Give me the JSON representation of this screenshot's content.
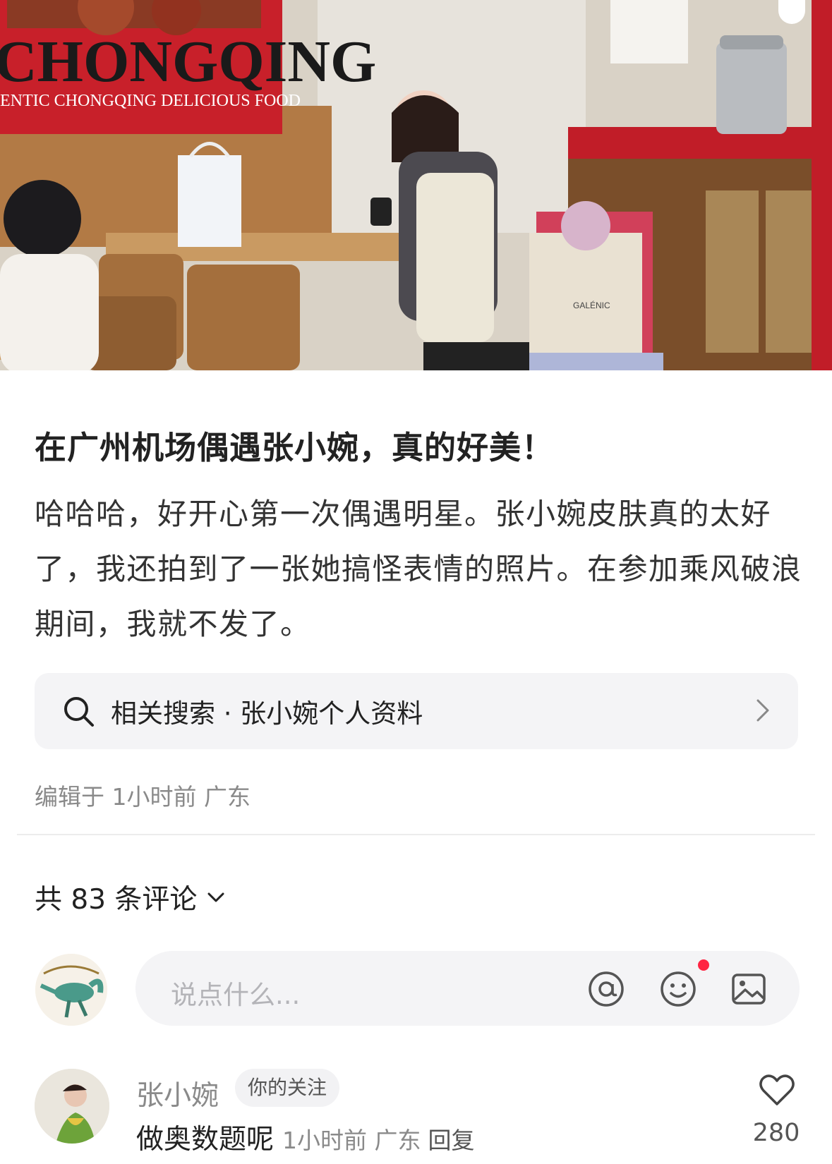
{
  "hero": {
    "sign_main": "CHONGQING",
    "sign_sub": "ENTIC CHONGQING DELICIOUS FOOD",
    "bag_brand": "GALÉNIC"
  },
  "post": {
    "title": "在广州机场偶遇张小婉，真的好美！",
    "body": "哈哈哈，好开心第一次偶遇明星。张小婉皮肤真的太好了，我还拍到了一张她搞怪表情的照片。在参加乘风破浪期间，我就不发了。",
    "related_search": "相关搜索 · 张小婉个人资料",
    "edited_meta": "编辑于 1小时前 广东"
  },
  "comments": {
    "count_label": "共 83 条评论",
    "input_placeholder": "说点什么...",
    "items": [
      {
        "author": "张小婉",
        "badge": "你的关注",
        "text": "做奥数题呢",
        "meta": "1小时前 广东",
        "reply_label": "回复",
        "likes": "280"
      }
    ]
  },
  "colors": {
    "accent_red": "#ff2442",
    "muted_text": "#8a8a8a",
    "input_bg": "#f4f4f6"
  },
  "icons": [
    "search-icon",
    "chevron-right-icon",
    "chevron-down-icon",
    "at-icon",
    "emoji-icon",
    "image-icon",
    "heart-icon"
  ]
}
